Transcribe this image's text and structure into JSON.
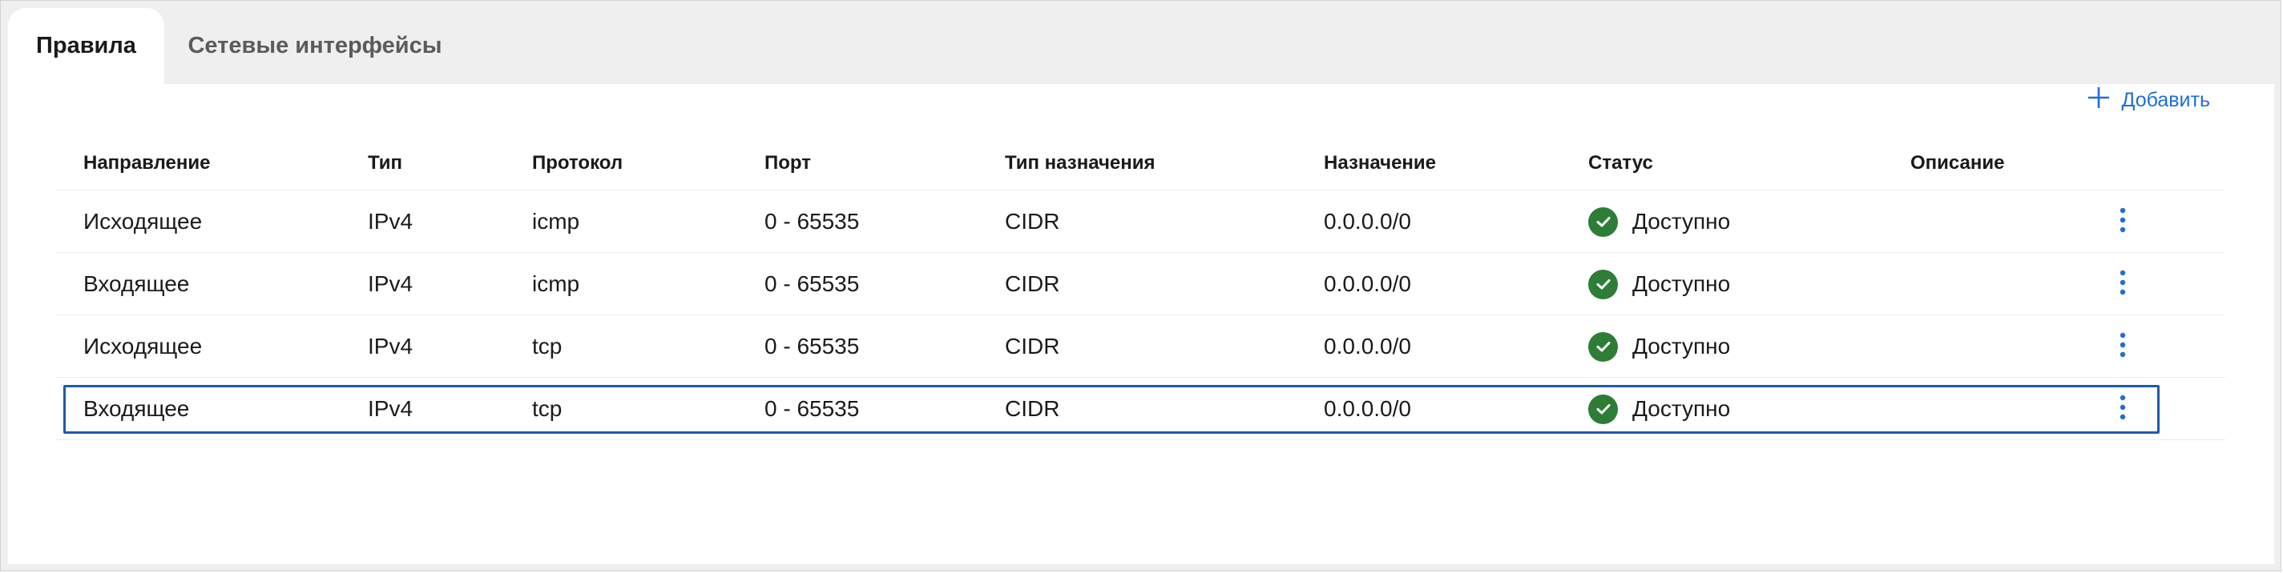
{
  "tabs": [
    {
      "label": "Правила",
      "active": true
    },
    {
      "label": "Сетевые интерфейсы",
      "active": false
    }
  ],
  "toolbar": {
    "add_label": "Добавить",
    "add_icon": "plus-icon"
  },
  "colors": {
    "accent": "#1f6ddb",
    "status_ok": "#2d7d37",
    "selection": "#1e5ba8"
  },
  "table": {
    "columns": [
      "Направление",
      "Тип",
      "Протокол",
      "Порт",
      "Тип назначения",
      "Назначение",
      "Статус",
      "Описание"
    ],
    "rows": [
      {
        "direction": "Исходящее",
        "type": "IPv4",
        "protocol": "icmp",
        "port": "0 - 65535",
        "dest_type": "CIDR",
        "destination": "0.0.0.0/0",
        "status": "Доступно",
        "description": ""
      },
      {
        "direction": "Входящее",
        "type": "IPv4",
        "protocol": "icmp",
        "port": "0 - 65535",
        "dest_type": "CIDR",
        "destination": "0.0.0.0/0",
        "status": "Доступно",
        "description": ""
      },
      {
        "direction": "Исходящее",
        "type": "IPv4",
        "protocol": "tcp",
        "port": "0 - 65535",
        "dest_type": "CIDR",
        "destination": "0.0.0.0/0",
        "status": "Доступно",
        "description": ""
      },
      {
        "direction": "Входящее",
        "type": "IPv4",
        "protocol": "tcp",
        "port": "0 - 65535",
        "dest_type": "CIDR",
        "destination": "0.0.0.0/0",
        "status": "Доступно",
        "description": "",
        "selected": true
      }
    ]
  }
}
